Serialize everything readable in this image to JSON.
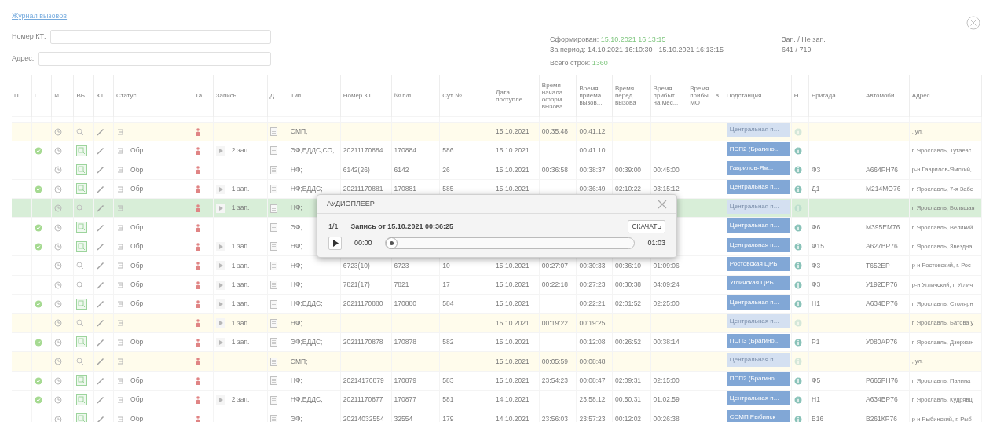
{
  "page": {
    "title": "Журнал вызовов"
  },
  "filters": [
    {
      "label": "Номер КТ:"
    },
    {
      "label": "Адрес:"
    }
  ],
  "summary": {
    "generated_label": "Сформирован:",
    "generated": "15.10.2021 16:13:15",
    "period": "За период: 14.10.2021 16:10:30 - 15.10.2021 16:13:15",
    "rows_label": "Всего строк:",
    "rows": "1360",
    "rec_label": "Зап. / Не зап.",
    "rec": "641 / 719"
  },
  "table": {
    "columns": [
      "П...",
      "П...",
      "И...",
      "ВБ",
      "КТ",
      "Статус",
      "Та...",
      "Запись",
      "Д...",
      "Тип",
      "Номер КТ",
      "№ п/п",
      "Сут №",
      "Дата поступле...",
      "Время начала оформ... вызова",
      "Время приема вызов...",
      "Время перед... вызова",
      "Время прибыт... на мес...",
      "Время прибы... в МО",
      "Подстанция",
      "Н...",
      "Бригада",
      "Автомоби...",
      "Адрес"
    ],
    "rows": [
      {
        "kind": "draft",
        "selected": false,
        "confirmed": false,
        "reviewed": false,
        "type": "СМП;",
        "date": "15.10.2021",
        "t_start": "00:35:48",
        "t_receive": "00:41:12",
        "substation": "Центральная п...",
        "address": ", ул."
      },
      {
        "kind": "normal",
        "selected": false,
        "confirmed": true,
        "reviewed": true,
        "status": "Обр",
        "recordings": "2 зап.",
        "type": "ЭФ;ЕДДС;СО;",
        "kt_number": "20211170884",
        "pp": "170884",
        "day_no": "586",
        "date": "15.10.2021",
        "t_receive": "00:41:10",
        "substation": "ПСП2 (Брагино...",
        "address": "г. Ярославль, Тутаевс"
      },
      {
        "kind": "normal",
        "selected": false,
        "confirmed": false,
        "reviewed": true,
        "status": "Обр",
        "type": "НФ;",
        "kt_number": "6142(26)",
        "pp": "6142",
        "day_no": "26",
        "date": "15.10.2021",
        "t_start": "00:36:58",
        "t_receive": "00:38:37",
        "t_transfer": "00:39:00",
        "t_arrive": "00:45:00",
        "substation": "Гаврилов-Ям...",
        "brigade": "Ф3",
        "car": "А664РН76",
        "address": "р-н Гаврилов-Ямский,"
      },
      {
        "kind": "normal",
        "selected": false,
        "confirmed": true,
        "reviewed": true,
        "status": "Обр",
        "recordings": "1 зап.",
        "type": "НФ;ЕДДС;",
        "kt_number": "20211170881",
        "pp": "170881",
        "day_no": "585",
        "date": "15.10.2021",
        "t_receive": "00:36:49",
        "t_transfer": "02:10:22",
        "t_arrive": "03:15:12",
        "substation": "Центральная п...",
        "brigade": "Д1",
        "car": "М214МО76",
        "address": "г. Ярославль, 7-я Забе"
      },
      {
        "kind": "draft",
        "selected": true,
        "confirmed": false,
        "reviewed": false,
        "recordings": "1 зап.",
        "type": "НФ;",
        "substation": "Центральная п...",
        "address": "г. Ярославль, Большая"
      },
      {
        "kind": "normal",
        "selected": false,
        "confirmed": true,
        "reviewed": true,
        "status": "Обр",
        "type": "ЭФ;",
        "substation": "Центральная п...",
        "brigade": "Ф6",
        "car": "М395ЕМ76",
        "address": "г. Ярославль, Великий"
      },
      {
        "kind": "normal",
        "selected": false,
        "confirmed": true,
        "reviewed": true,
        "status": "Обр",
        "recordings": "1 зап.",
        "type": "НФ;",
        "substation": "Центральная п...",
        "brigade": "Ф15",
        "car": "А627ВР76",
        "address": "г. Ярославль, Звездна"
      },
      {
        "kind": "normal",
        "selected": false,
        "confirmed": false,
        "reviewed": false,
        "status": "Обр",
        "recordings": "1 зап.",
        "type": "НФ;",
        "kt_number": "6723(10)",
        "pp": "6723",
        "day_no": "10",
        "date": "15.10.2021",
        "t_start": "00:27:07",
        "t_receive": "00:30:33",
        "t_transfer": "00:36:10",
        "t_arrive": "01:09:06",
        "substation": "Ростовская ЦРБ",
        "brigade": "Ф3",
        "car": "Т652ЕР",
        "address": "р-н Ростовский, г. Рос"
      },
      {
        "kind": "normal",
        "selected": false,
        "confirmed": false,
        "reviewed": false,
        "status": "Обр",
        "recordings": "1 зап.",
        "type": "НФ;",
        "kt_number": "7821(17)",
        "pp": "7821",
        "day_no": "17",
        "date": "15.10.2021",
        "t_start": "00:22:18",
        "t_receive": "00:27:23",
        "t_transfer": "00:30:38",
        "t_arrive": "04:09:24",
        "substation": "Угличская ЦРБ",
        "brigade": "Ф3",
        "car": "У192ЕР76",
        "address": "р-н Угличский, г. Углич"
      },
      {
        "kind": "normal",
        "selected": false,
        "confirmed": true,
        "reviewed": true,
        "status": "Обр",
        "recordings": "1 зап.",
        "type": "НФ;ЕДДС;",
        "kt_number": "20211170880",
        "pp": "170880",
        "day_no": "584",
        "date": "15.10.2021",
        "t_receive": "00:22:21",
        "t_transfer": "02:01:52",
        "t_arrive": "02:25:00",
        "substation": "Центральная п...",
        "brigade": "Н1",
        "car": "А634ВР76",
        "address": "г. Ярославль, Столярн"
      },
      {
        "kind": "draft",
        "selected": false,
        "confirmed": false,
        "reviewed": false,
        "recordings": "1 зап.",
        "type": "НФ;",
        "date": "15.10.2021",
        "t_start": "00:19:22",
        "t_receive": "00:19:25",
        "substation": "Центральная п...",
        "address": "г. Ярославль, Батова у"
      },
      {
        "kind": "normal",
        "selected": false,
        "confirmed": true,
        "reviewed": true,
        "status": "Обр",
        "recordings": "1 зап.",
        "type": "ЭФ;ЕДДС;",
        "kt_number": "20211170878",
        "pp": "170878",
        "day_no": "582",
        "date": "15.10.2021",
        "t_receive": "00:12:08",
        "t_transfer": "00:26:52",
        "t_arrive": "00:38:14",
        "substation": "ПСП3 (Брагино...",
        "brigade": "Р1",
        "car": "У080АР76",
        "address": "г. Ярославль, Дзержин"
      },
      {
        "kind": "draft",
        "selected": false,
        "confirmed": false,
        "reviewed": false,
        "type": "СМП;",
        "date": "15.10.2021",
        "t_start": "00:05:59",
        "t_receive": "00:08:48",
        "substation": "Центральная п...",
        "address": ", ул."
      },
      {
        "kind": "normal",
        "selected": false,
        "confirmed": true,
        "reviewed": true,
        "status": "Обр",
        "type": "НФ;",
        "kt_number": "20214170879",
        "pp": "170879",
        "day_no": "583",
        "date": "15.10.2021",
        "t_start": "23:54:23",
        "t_receive": "00:08:47",
        "t_transfer": "02:09:31",
        "t_arrive": "02:15:00",
        "substation": "ПСП2 (Брагино...",
        "brigade": "Ф5",
        "car": "Р665РН76",
        "address": "г. Ярославль, Панина"
      },
      {
        "kind": "normal",
        "selected": false,
        "confirmed": true,
        "reviewed": true,
        "status": "Обр",
        "recordings": "2 зап.",
        "type": "НФ;ЕДДС;",
        "kt_number": "20211170877",
        "pp": "170877",
        "day_no": "581",
        "date": "14.10.2021",
        "t_receive": "23:58:12",
        "t_transfer": "00:50:31",
        "t_arrive": "01:02:59",
        "substation": "Центральная п...",
        "brigade": "Н1",
        "car": "А634ВР76",
        "address": "г. Ярославль, Кудрявц"
      },
      {
        "kind": "normal",
        "selected": false,
        "confirmed": false,
        "reviewed": true,
        "status": "Обр",
        "type": "ЭФ;",
        "kt_number": "20214032554",
        "pp": "32554",
        "day_no": "179",
        "date": "14.10.2021",
        "t_start": "23:56:03",
        "t_receive": "23:57:23",
        "t_transfer": "00:12:02",
        "t_arrive": "00:26:38",
        "substation": "ССМП Рыбинск",
        "brigade": "В16",
        "car": "В261КР76",
        "address": "р-н Рыбинский, г. Рыб"
      }
    ]
  },
  "player": {
    "title": "АУДИОПЛЕЕР",
    "counter": "1/1",
    "record": "Запись от 15.10.2021 00:36:25",
    "download": "СКАЧАТЬ",
    "current": "00:00",
    "level": 0,
    "duration": "01:03"
  }
}
